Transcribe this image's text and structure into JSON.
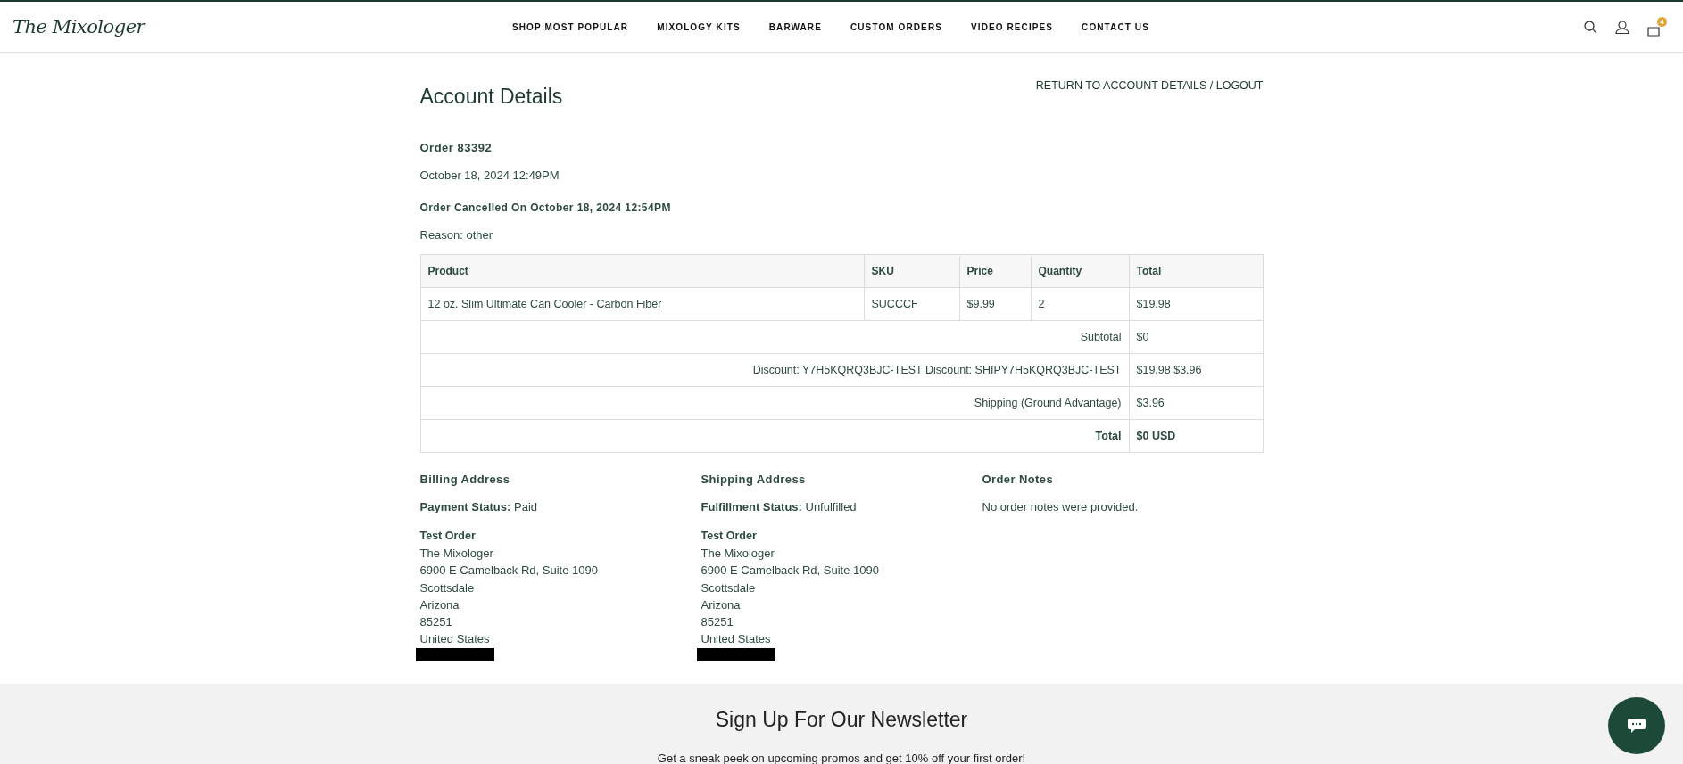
{
  "header": {
    "logo": "The Mixologer",
    "nav": [
      "SHOP MOST POPULAR",
      "MIXOLOGY KITS",
      "BARWARE",
      "CUSTOM ORDERS",
      "VIDEO RECIPES",
      "CONTACT US"
    ],
    "cart_count": "4"
  },
  "page": {
    "title": "Account Details",
    "top_link": "RETURN TO ACCOUNT DETAILS / LOGOUT",
    "order": "Order 83392",
    "date": "October 18, 2024 12:49PM",
    "cancelled": "Order Cancelled On October 18, 2024 12:54PM",
    "reason": "Reason: other"
  },
  "table": {
    "columns": [
      "Product",
      "SKU",
      "Price",
      "Quantity",
      "Total"
    ],
    "rows": [
      [
        "12 oz. Slim Ultimate Can Cooler - Carbon Fiber",
        "SUCCCF",
        "$9.99",
        "2",
        "$19.98"
      ]
    ],
    "summary": [
      {
        "label": "Subtotal",
        "value": "$0",
        "bold": false
      },
      {
        "label": "Discount: Y7H5KQRQ3BJC-TEST Discount: SHIPY7H5KQRQ3BJC-TEST",
        "value": "$19.98 $3.96",
        "bold": false
      },
      {
        "label": "Shipping (Ground Advantage)",
        "value": "$3.96",
        "bold": false
      },
      {
        "label": "Total",
        "value": "$0 USD",
        "bold": true
      }
    ]
  },
  "addresses": [
    {
      "title": "Billing Address",
      "status_label": "Payment Status:",
      "status": "Paid",
      "name": "Test Order",
      "lines": [
        "The Mixologer",
        "6900 E Camelback Rd, Suite 1090",
        "Scottsdale",
        "Arizona",
        "85251",
        "United States"
      ],
      "redacted": true
    },
    {
      "title": "Shipping Address",
      "status_label": "Fulfillment Status:",
      "status": "Unfulfilled",
      "name": "Test Order",
      "lines": [
        "The Mixologer",
        "6900 E Camelback Rd, Suite 1090",
        "Scottsdale",
        "Arizona",
        "85251",
        "United States"
      ],
      "redacted": true
    }
  ],
  "notes": {
    "title": "Order Notes",
    "text": "No order notes were provided."
  },
  "newsletter": {
    "title": "Sign Up For Our Newsletter",
    "text": "Get a sneak peek on upcoming promos and get 10% off your first order!"
  }
}
